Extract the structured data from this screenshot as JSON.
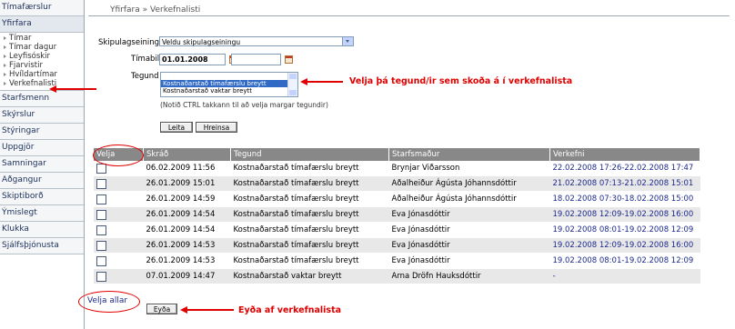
{
  "sidebar": {
    "items": [
      {
        "label": "Tímafærslur"
      },
      {
        "label": "Yfirfara"
      }
    ],
    "sub_items": [
      {
        "label": "Tímar"
      },
      {
        "label": "Tímar dagur"
      },
      {
        "label": "Leyfisóskir"
      },
      {
        "label": "Fjarvistir"
      },
      {
        "label": "Hvíldartímar"
      },
      {
        "label": "Verkefnalisti"
      }
    ],
    "items_after": [
      {
        "label": "Starfsmenn"
      },
      {
        "label": "Skýrslur"
      },
      {
        "label": "Stýringar"
      },
      {
        "label": "Uppgjör"
      },
      {
        "label": "Samningar"
      },
      {
        "label": "Aðgangur"
      },
      {
        "label": "Skiptiborð"
      },
      {
        "label": "Ýmislegt"
      },
      {
        "label": "Klukka"
      },
      {
        "label": "Sjálfsþjónusta"
      }
    ]
  },
  "breadcrumb": "Yfirfara » Verkefnalisti",
  "form": {
    "unit_label": "Skipulagseining",
    "unit_value": "Veldu skipulagseiningu",
    "period_label": "Tímabil",
    "date_from": "01.01.2008",
    "date_to": "",
    "type_label": "Tegund",
    "type_options": [
      {
        "label": ""
      },
      {
        "label": "Kostnaðarstað tímafærslu breytt"
      },
      {
        "label": "Kostnaðarstað vaktar breytt"
      }
    ],
    "hint": "(Notið CTRL takkann til að velja margar tegundir)",
    "search_button": "Leita",
    "clear_button": "Hreinsa"
  },
  "table": {
    "headers": [
      "Velja",
      "Skráð",
      "Tegund",
      "Starfsmaður",
      "Verkefni"
    ],
    "rows": [
      {
        "date": "06.02.2009 11:56",
        "type": "Kostnaðarstað tímafærslu breytt",
        "employee": "Brynjar Viðarsson",
        "task": "22.02.2008 17:26-22.02.2008 17:47"
      },
      {
        "date": "26.01.2009 15:01",
        "type": "Kostnaðarstað tímafærslu breytt",
        "employee": "Aðalheiður Ágústa Jóhannsdóttir",
        "task": "21.02.2008 07:13-21.02.2008 15:01"
      },
      {
        "date": "26.01.2009 14:59",
        "type": "Kostnaðarstað tímafærslu breytt",
        "employee": "Aðalheiður Ágústa Jóhannsdóttir",
        "task": "18.02.2008 07:30-18.02.2008 15:00"
      },
      {
        "date": "26.01.2009 14:54",
        "type": "Kostnaðarstað tímafærslu breytt",
        "employee": "Eva Jónasdóttir",
        "task": "19.02.2008 12:09-19.02.2008 16:00"
      },
      {
        "date": "26.01.2009 14:54",
        "type": "Kostnaðarstað tímafærslu breytt",
        "employee": "Eva Jónasdóttir",
        "task": "19.02.2008 08:01-19.02.2008 12:09"
      },
      {
        "date": "26.01.2009 14:53",
        "type": "Kostnaðarstað tímafærslu breytt",
        "employee": "Eva Jónasdóttir",
        "task": "19.02.2008 12:09-19.02.2008 16:00"
      },
      {
        "date": "26.01.2009 14:53",
        "type": "Kostnaðarstað tímafærslu breytt",
        "employee": "Eva Jónasdóttir",
        "task": "19.02.2008 08:01-19.02.2008 12:09"
      },
      {
        "date": "07.01.2009 14:47",
        "type": "Kostnaðarstað vaktar breytt",
        "employee": "Arna Dröfn Hauksdóttir",
        "task": "-"
      }
    ]
  },
  "select_all": "Velja allar",
  "delete_button": "Eyða",
  "annotations": {
    "type_note": "Velja þá tegund/ir sem skoða á í verkefnalista",
    "delete_note": "Eyða af verkefnalista"
  },
  "colors": {
    "annotation": "#e00000",
    "header_bg": "#888888",
    "link": "#1d2a8c"
  }
}
